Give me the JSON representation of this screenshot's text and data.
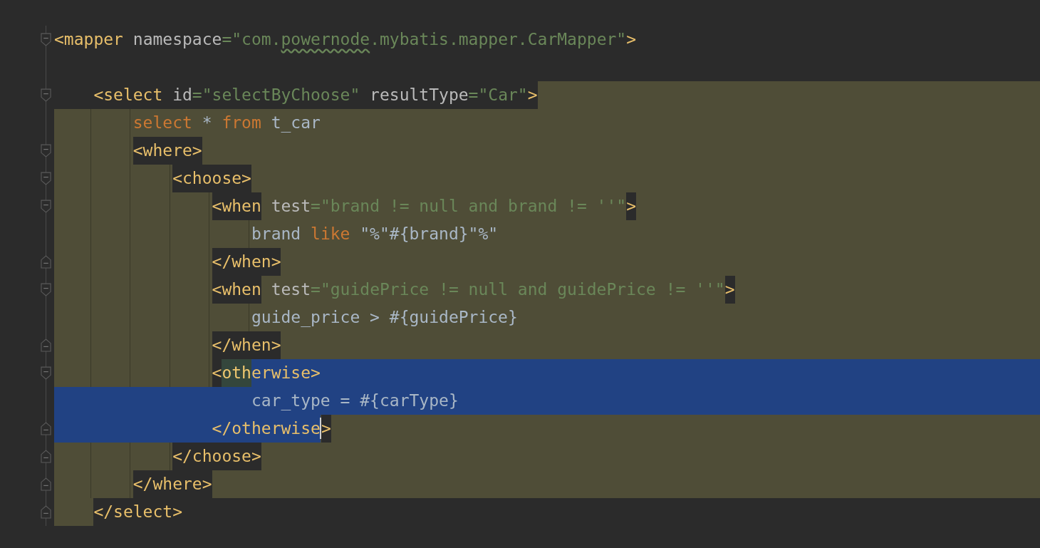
{
  "lines": [
    {
      "fold_start": true,
      "tokens": [
        {
          "kind": "tag",
          "text": "<mapper"
        },
        {
          "kind": "attr",
          "text": " namespace"
        },
        {
          "kind": "value",
          "text": "=\"com."
        },
        {
          "kind": "value",
          "text": "powernode",
          "typo": true
        },
        {
          "kind": "value",
          "text": ".mybatis.mapper.CarMapper\""
        },
        {
          "kind": "tag",
          "text": ">"
        }
      ],
      "children": [
        {
          "kind": "blank"
        },
        {
          "kind": "start",
          "fold_start": true,
          "tokens": [
            {
              "kind": "tag",
              "text": "<select"
            },
            {
              "kind": "attr",
              "text": " id"
            },
            {
              "kind": "value",
              "text": "=\"selectByChoose\""
            },
            {
              "kind": "attr",
              "text": " resultType"
            },
            {
              "kind": "value",
              "text": "=\"Car\""
            },
            {
              "kind": "tag",
              "text": ">"
            }
          ],
          "children": [
            {
              "kind": "body",
              "tokens": [
                {
                  "kind": "keyword",
                  "text": "select"
                },
                {
                  "kind": "text",
                  "text": " * "
                },
                {
                  "kind": "keyword",
                  "text": "from"
                },
                {
                  "kind": "text",
                  "text": " t_car"
                }
              ]
            },
            {
              "kind": "body",
              "fold_start": true,
              "tokens": [
                {
                  "kind": "tag",
                  "text": "<where>"
                }
              ],
              "children": [
                {
                  "kind": "body",
                  "fold_start": true,
                  "tokens": [
                    {
                      "kind": "tag",
                      "text": "<choose>"
                    }
                  ],
                  "children": [
                    {
                      "kind": "body",
                      "fold_start": true,
                      "tokens": [
                        {
                          "kind": "tag",
                          "text": "<when"
                        },
                        {
                          "kind": "attr",
                          "text": " test"
                        },
                        {
                          "kind": "value",
                          "text": "=\"brand != null and brand != ''\""
                        },
                        {
                          "kind": "tag",
                          "text": ">"
                        }
                      ],
                      "children": [
                        {
                          "kind": "body",
                          "tokens": [
                            {
                              "kind": "text",
                              "text": "brand "
                            },
                            {
                              "kind": "keyword",
                              "text": "like"
                            },
                            {
                              "kind": "text",
                              "text": " \"%\"#{brand}\"%\""
                            }
                          ]
                        }
                      ]
                    },
                    {
                      "kind": "body",
                      "fold_end": true,
                      "tokens": [
                        {
                          "kind": "tag",
                          "text": "</when>"
                        }
                      ]
                    },
                    {
                      "kind": "body",
                      "fold_start": true,
                      "tokens": [
                        {
                          "kind": "tag",
                          "text": "<when"
                        },
                        {
                          "kind": "attr",
                          "text": " test"
                        },
                        {
                          "kind": "value",
                          "text": "=\"guidePrice != null and guidePrice != ''\""
                        },
                        {
                          "kind": "tag",
                          "text": ">"
                        }
                      ],
                      "children": [
                        {
                          "kind": "body",
                          "tokens": [
                            {
                              "kind": "text",
                              "text": "guide_price > #{guidePrice}"
                            }
                          ]
                        }
                      ]
                    },
                    {
                      "kind": "body",
                      "fold_end": true,
                      "tokens": [
                        {
                          "kind": "tag",
                          "text": "</when>"
                        }
                      ]
                    },
                    {
                      "kind": "body",
                      "fold_start": true,
                      "selected_to_end": true,
                      "tokens": [
                        {
                          "kind": "tag",
                          "text": "<",
                          "selected": false
                        },
                        {
                          "kind": "tag",
                          "text": "oth",
                          "selected": false,
                          "matched": true
                        },
                        {
                          "kind": "tag",
                          "text": "erwise>",
                          "selected": true
                        }
                      ],
                      "children": [
                        {
                          "kind": "body",
                          "indent_selected": true,
                          "selected_to_end": true,
                          "tokens": [
                            {
                              "kind": "text",
                              "text": "car_type = #{carType}",
                              "selected": true
                            }
                          ]
                        }
                      ]
                    },
                    {
                      "kind": "body",
                      "fold_end": true,
                      "indent_selected": true,
                      "selected_to_end": false,
                      "tokens": [
                        {
                          "kind": "tag",
                          "text": "</otherwise",
                          "selected": true,
                          "caret": true
                        },
                        {
                          "kind": "tag",
                          "text": ">",
                          "selected": false
                        }
                      ]
                    }
                  ]
                },
                {
                  "kind": "body",
                  "fold_end": true,
                  "tokens": [
                    {
                      "kind": "tag",
                      "text": "</choose>"
                    }
                  ]
                }
              ]
            },
            {
              "kind": "body",
              "fold_end": true,
              "tokens": [
                {
                  "kind": "tag",
                  "text": "</where>"
                }
              ]
            }
          ]
        },
        {
          "kind": "end",
          "fold_end": true,
          "tokens": [
            {
              "kind": "tag",
              "text": "</select>"
            }
          ]
        }
      ]
    }
  ]
}
